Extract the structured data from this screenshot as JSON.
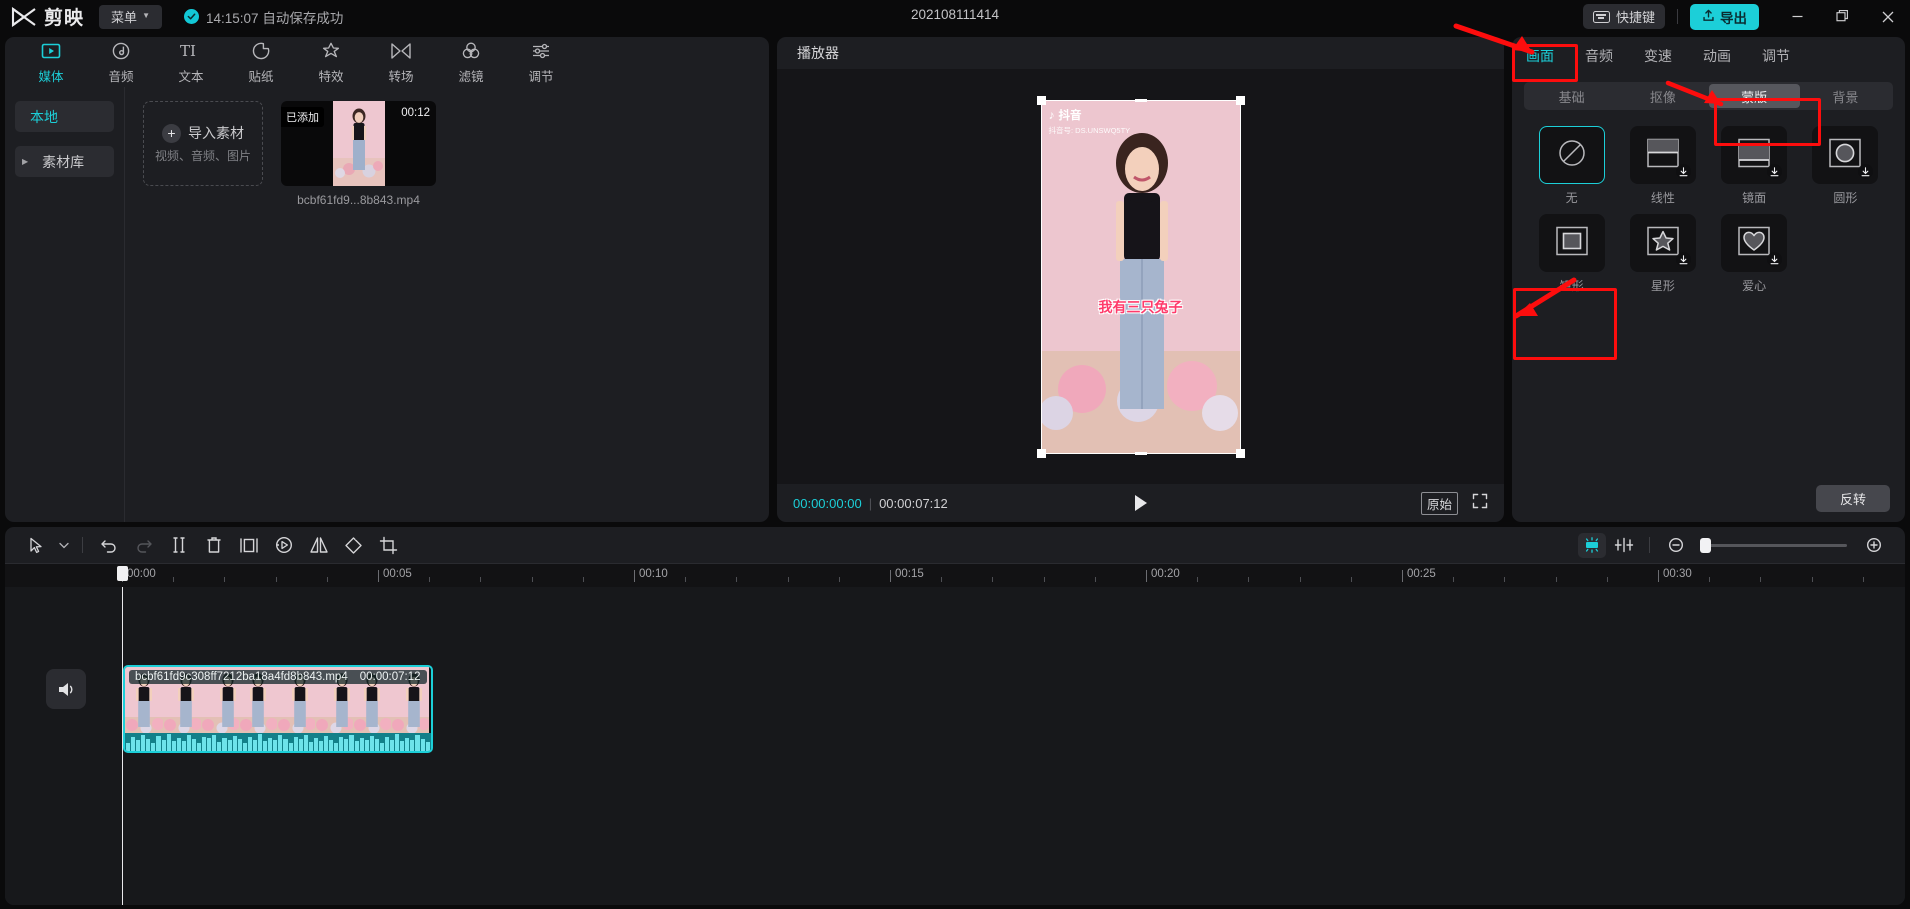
{
  "titlebar": {
    "app_name": "剪映",
    "menu_label": "菜单",
    "save_status": "14:15:07 自动保存成功",
    "project_title": "202108111414",
    "shortcut_label": "快捷键",
    "export_label": "导出",
    "window_buttons": [
      "minimize",
      "maximize",
      "close"
    ]
  },
  "left_panel": {
    "function_tabs": [
      {
        "label": "媒体",
        "icon": "media-icon",
        "active": true
      },
      {
        "label": "音频",
        "icon": "audio-icon",
        "active": false
      },
      {
        "label": "文本",
        "icon": "text-icon",
        "active": false
      },
      {
        "label": "贴纸",
        "icon": "sticker-icon",
        "active": false
      },
      {
        "label": "特效",
        "icon": "effects-icon",
        "active": false
      },
      {
        "label": "转场",
        "icon": "transition-icon",
        "active": false
      },
      {
        "label": "滤镜",
        "icon": "filter-icon",
        "active": false
      },
      {
        "label": "调节",
        "icon": "adjust-icon",
        "active": false
      }
    ],
    "library_items": [
      {
        "label": "本地",
        "active": true,
        "expandable": false
      },
      {
        "label": "素材库",
        "active": false,
        "expandable": true
      }
    ],
    "import_box": {
      "title": "导入素材",
      "subtitle": "视频、音频、图片",
      "plus": "+"
    },
    "media_items": [
      {
        "badge": "已添加",
        "duration": "00:12",
        "filename": "bcbf61fd9...8b843.mp4"
      }
    ]
  },
  "player": {
    "title": "播放器",
    "current_time": "00:00:00:00",
    "divider": "|",
    "total_time": "00:00:07:12",
    "play_icon": "play-icon",
    "quality_label": "原始",
    "fullscreen_icon": "fullscreen-icon",
    "video_overlay": {
      "watermark_app": "抖音",
      "watermark_id": "抖音号: DS.UNSWQ5TY",
      "subtitle": "我有三只兔子"
    }
  },
  "right_panel": {
    "tabs": [
      {
        "label": "画面",
        "active": true
      },
      {
        "label": "音频",
        "active": false
      },
      {
        "label": "变速",
        "active": false
      },
      {
        "label": "动画",
        "active": false
      },
      {
        "label": "调节",
        "active": false
      }
    ],
    "sub_tabs": [
      {
        "label": "基础",
        "active": false
      },
      {
        "label": "抠像",
        "active": false
      },
      {
        "label": "蒙版",
        "active": true
      },
      {
        "label": "背景",
        "active": false
      }
    ],
    "masks": [
      {
        "label": "无",
        "icon": "none-mask-icon",
        "selected": true,
        "downloadable": false
      },
      {
        "label": "线性",
        "icon": "linear-mask-icon",
        "selected": false,
        "downloadable": true
      },
      {
        "label": "镜面",
        "icon": "mirror-mask-icon",
        "selected": false,
        "downloadable": true
      },
      {
        "label": "圆形",
        "icon": "circle-mask-icon",
        "selected": false,
        "downloadable": true
      },
      {
        "label": "矩形",
        "icon": "rect-mask-icon",
        "selected": false,
        "downloadable": false
      },
      {
        "label": "星形",
        "icon": "star-mask-icon",
        "selected": false,
        "downloadable": true
      },
      {
        "label": "爱心",
        "icon": "heart-mask-icon",
        "selected": false,
        "downloadable": true
      }
    ],
    "reverse_label": "反转"
  },
  "timeline": {
    "tools": [
      {
        "name": "select-tool",
        "icon": "cursor-icon",
        "enabled": true
      },
      {
        "name": "select-dropdown",
        "icon": "chevron-down-icon",
        "enabled": true
      },
      {
        "name": "undo",
        "icon": "undo-icon",
        "enabled": true
      },
      {
        "name": "redo",
        "icon": "redo-icon",
        "enabled": false
      },
      {
        "name": "split",
        "icon": "split-icon",
        "enabled": true
      },
      {
        "name": "delete",
        "icon": "trash-icon",
        "enabled": true
      },
      {
        "name": "crop-clip",
        "icon": "clip-crop-icon",
        "enabled": true
      },
      {
        "name": "freeze",
        "icon": "freeze-icon",
        "enabled": true
      },
      {
        "name": "mirror",
        "icon": "mirror-icon",
        "enabled": true
      },
      {
        "name": "rotate",
        "icon": "rotate-icon",
        "enabled": true
      },
      {
        "name": "crop",
        "icon": "crop-icon",
        "enabled": true
      }
    ],
    "right_tools": [
      {
        "name": "auto-fit",
        "icon": "auto-fit-icon",
        "enabled": true
      },
      {
        "name": "snap-toggle",
        "icon": "magnet-snap-icon",
        "enabled": true
      },
      {
        "name": "zoom-out",
        "icon": "zoom-out-icon",
        "enabled": true
      },
      {
        "name": "zoom-in",
        "icon": "zoom-in-icon",
        "enabled": true
      }
    ],
    "ruler_labels": [
      "00:00",
      "00:05",
      "00:10",
      "00:15",
      "00:20",
      "00:25",
      "00:30"
    ],
    "clip": {
      "name": "bcbf61fd9c308ff7212ba18a4fd8b843.mp4",
      "duration": "00:00:07:12"
    },
    "mute_icon": "speaker-icon"
  },
  "annotations": {
    "accent": "#fd0d0d",
    "items": [
      {
        "type": "arrow",
        "target": "画面 tab"
      },
      {
        "type": "rect",
        "target": "画面 tab"
      },
      {
        "type": "arrow",
        "target": "蒙版 sub-tab"
      },
      {
        "type": "rect",
        "target": "蒙版 sub-tab"
      },
      {
        "type": "arrow",
        "target": "矩形 mask"
      },
      {
        "type": "rect",
        "target": "矩形 mask"
      }
    ]
  },
  "colors": {
    "accent_teal": "#1ccfd8",
    "panel_bg": "#1d1e22",
    "app_bg": "#0a0a0b",
    "annotation_red": "#fd0d0d"
  }
}
